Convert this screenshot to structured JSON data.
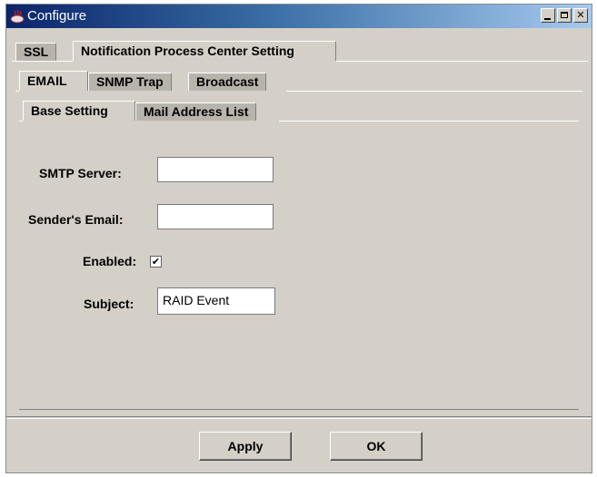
{
  "window": {
    "title": "Configure",
    "app_icon": "java-app-icon",
    "controls": {
      "minimize": "minimize-icon",
      "maximize": "maximize-icon",
      "close": "close-icon"
    }
  },
  "tabs_level1": {
    "items": [
      "SSL",
      "Notification Process Center Setting"
    ],
    "selected": "Notification Process Center Setting"
  },
  "tabs_level2": {
    "items": [
      "EMAIL",
      "SNMP Trap",
      "Broadcast"
    ],
    "selected": "EMAIL"
  },
  "tabs_level3": {
    "items": [
      "Base Setting",
      "Mail Address List"
    ],
    "selected": "Base Setting"
  },
  "form": {
    "smtp_label": "SMTP Server:",
    "smtp_value": "",
    "sender_label": "Sender's Email:",
    "sender_value": "",
    "enabled_label": "Enabled:",
    "enabled_checked": true,
    "checkmark": "✔",
    "subject_label": "Subject:",
    "subject_value": "RAID Event"
  },
  "buttons": {
    "apply": "Apply",
    "ok": "OK"
  },
  "colors": {
    "face": "#d4d0c8",
    "titlebar": "#0a246a"
  }
}
